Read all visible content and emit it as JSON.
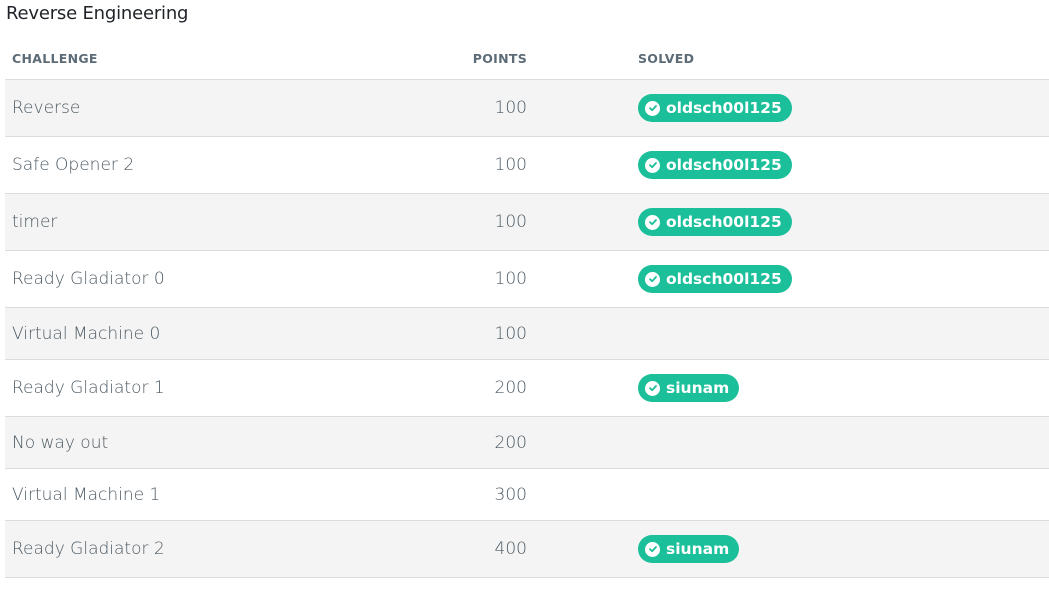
{
  "section": {
    "title": "Reverse Engineering"
  },
  "table": {
    "headers": {
      "challenge": "CHALLENGE",
      "points": "POINTS",
      "solved": "SOLVED"
    },
    "rows": [
      {
        "challenge": "Reverse",
        "points": "100",
        "solved_by": "oldsch00l125"
      },
      {
        "challenge": "Safe Opener 2",
        "points": "100",
        "solved_by": "oldsch00l125"
      },
      {
        "challenge": "timer",
        "points": "100",
        "solved_by": "oldsch00l125"
      },
      {
        "challenge": "Ready Gladiator 0",
        "points": "100",
        "solved_by": "oldsch00l125"
      },
      {
        "challenge": "Virtual Machine 0",
        "points": "100",
        "solved_by": ""
      },
      {
        "challenge": "Ready Gladiator 1",
        "points": "200",
        "solved_by": "siunam"
      },
      {
        "challenge": "No way out",
        "points": "200",
        "solved_by": ""
      },
      {
        "challenge": "Virtual Machine 1",
        "points": "300",
        "solved_by": ""
      },
      {
        "challenge": "Ready Gladiator 2",
        "points": "400",
        "solved_by": "siunam"
      }
    ]
  },
  "colors": {
    "badge": "#1bbf9a",
    "alt_row": "#f4f4f4",
    "header_text": "#5c6b76",
    "body_text": "#4d5a63",
    "divider": "#d9dde0"
  },
  "icons": {
    "solved": "check-circle-icon"
  }
}
